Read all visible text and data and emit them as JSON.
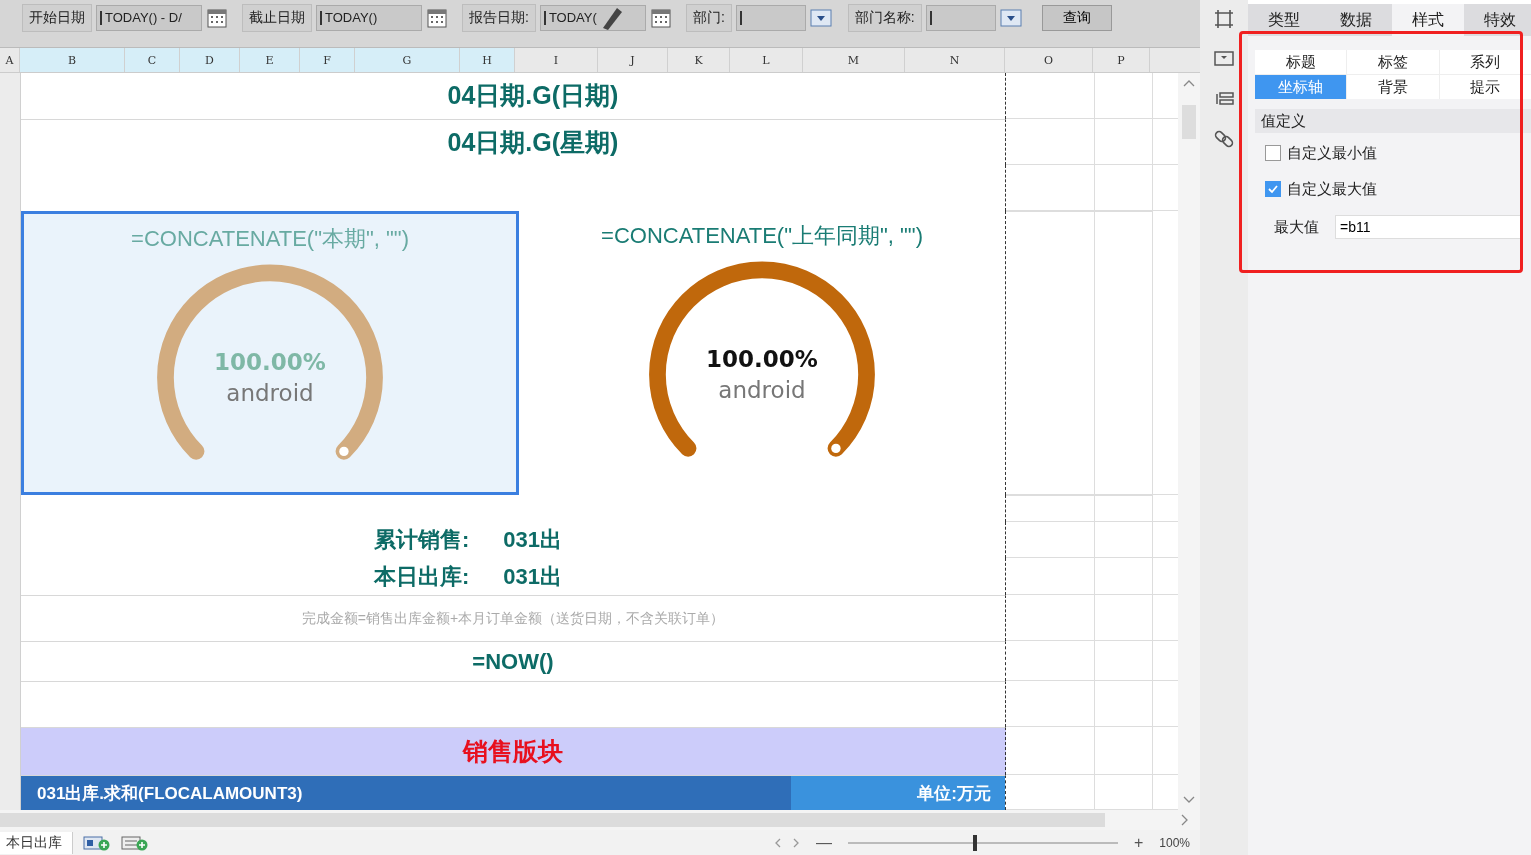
{
  "toolbar": [
    {
      "kind": "label",
      "text": "开始日期"
    },
    {
      "kind": "date",
      "value": "TODAY() - D/"
    },
    {
      "kind": "label",
      "text": "截止日期"
    },
    {
      "kind": "date",
      "value": "TODAY()"
    },
    {
      "kind": "label",
      "text": "报告日期:"
    },
    {
      "kind": "date",
      "value": "TODAY(",
      "covered": true
    },
    {
      "kind": "label",
      "text": "部门:"
    },
    {
      "kind": "combo"
    },
    {
      "kind": "label",
      "text": "部门名称:"
    },
    {
      "kind": "combo"
    },
    {
      "kind": "button",
      "text": "查询"
    }
  ],
  "columns": [
    {
      "label": "A",
      "selected": false
    },
    {
      "label": "B",
      "selected": true
    },
    {
      "label": "C",
      "selected": true
    },
    {
      "label": "D",
      "selected": true
    },
    {
      "label": "E",
      "selected": true
    },
    {
      "label": "F",
      "selected": true
    },
    {
      "label": "G",
      "selected": true
    },
    {
      "label": "H",
      "selected": true
    },
    {
      "label": "I",
      "selected": false
    },
    {
      "label": "J",
      "selected": false
    },
    {
      "label": "K",
      "selected": false
    },
    {
      "label": "L",
      "selected": false
    },
    {
      "label": "M",
      "selected": false
    },
    {
      "label": "N",
      "selected": false
    },
    {
      "label": "O",
      "selected": false
    },
    {
      "label": "P",
      "selected": false
    }
  ],
  "report": {
    "titles": [
      "04日期.G(日期)",
      "04日期.G(星期)"
    ],
    "gauges": [
      {
        "title": "=CONCATENATE(\"本期\", \"\")",
        "value": "100.00%",
        "label": "android",
        "selected": true
      },
      {
        "title": "=CONCATENATE(\"上年同期\", \"\")",
        "value": "100.00%",
        "label": "android",
        "selected": false
      }
    ],
    "summary": [
      {
        "label": "累计销售:",
        "value": "031出"
      },
      {
        "label": "本日出库:",
        "value": "031出"
      }
    ],
    "note": "完成金额=销售出库金额+本月订单金额（送货日期，不含关联订单）",
    "now": "=NOW()",
    "section": "销售版块",
    "bar": {
      "left": "031出库.求和(FLOCALAMOUNT3)",
      "right": "单位:万元"
    }
  },
  "bottom": {
    "sheet_tabs": [
      {
        "label": "本日出库",
        "selected": true
      }
    ],
    "zoom_out": "—",
    "zoom_in": "+",
    "zoom": {
      "level": 0.47,
      "reading": "100%"
    }
  },
  "panel": {
    "tabs": [
      {
        "label": "类型",
        "selected": false
      },
      {
        "label": "数据",
        "selected": false
      },
      {
        "label": "样式",
        "selected": true
      },
      {
        "label": "特效",
        "selected": false
      }
    ],
    "subtabs": [
      {
        "label": "标题",
        "selected": false
      },
      {
        "label": "标签",
        "selected": false
      },
      {
        "label": "系列",
        "selected": false
      },
      {
        "label": "坐标轴",
        "selected": true
      },
      {
        "label": "背景",
        "selected": false
      },
      {
        "label": "提示",
        "selected": false
      }
    ],
    "section": "值定义",
    "checkboxes": [
      {
        "label": "自定义最小值",
        "checked": false
      },
      {
        "label": "自定义最大值",
        "checked": true
      }
    ],
    "max_field": {
      "label": "最大值",
      "value": "=b11"
    }
  }
}
